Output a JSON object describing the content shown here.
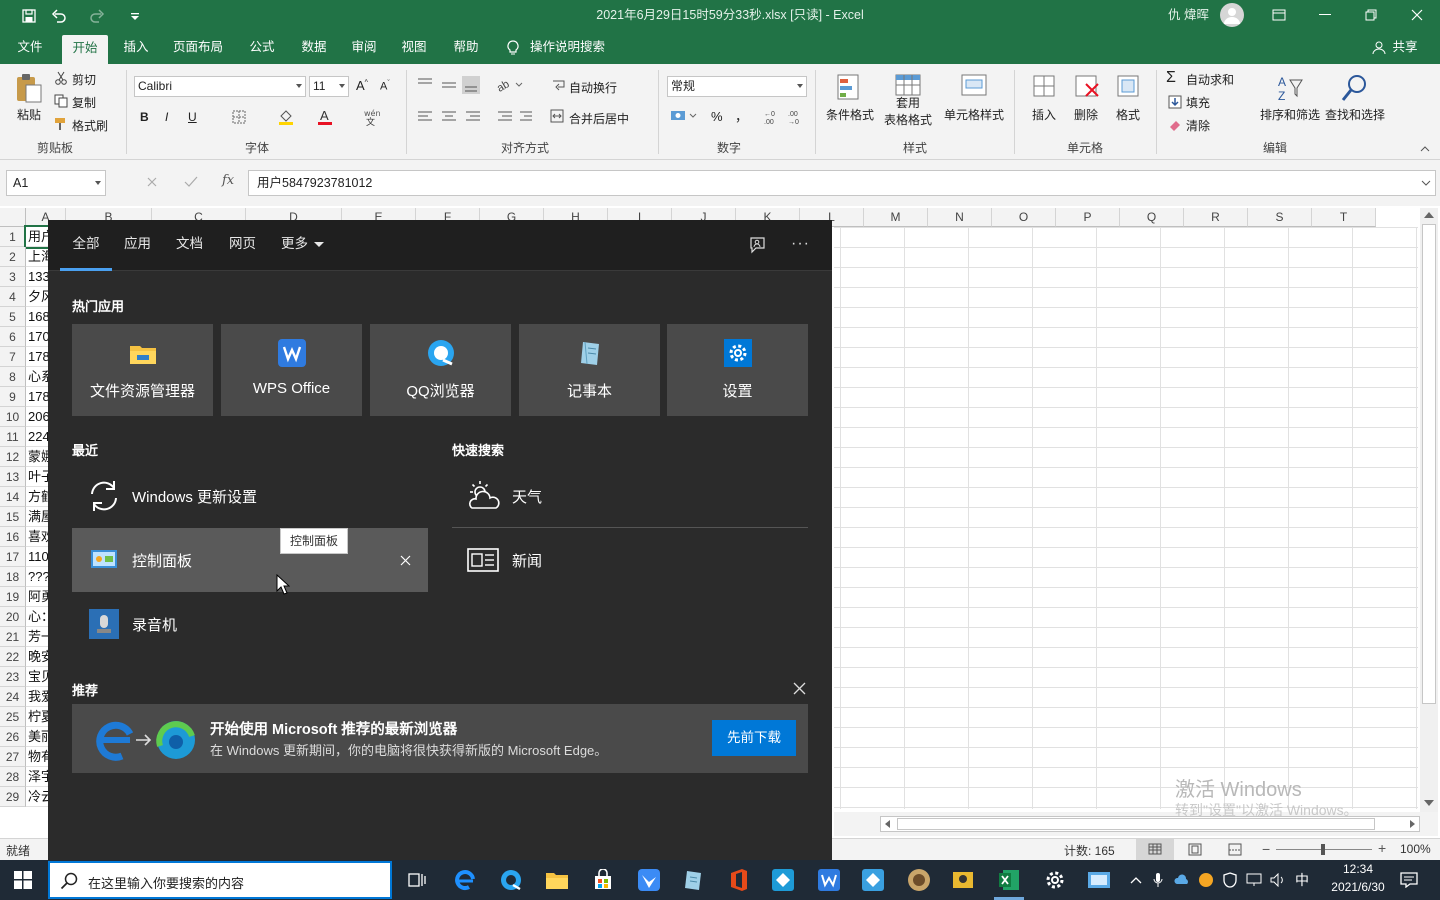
{
  "title_bar": {
    "document_title": "2021年6月29日15时59分33秒.xlsx [只读] - Excel",
    "user": "仇 煒晖",
    "brand_color": "#217346"
  },
  "ribbon_tabs": [
    "文件",
    "开始",
    "插入",
    "页面布局",
    "公式",
    "数据",
    "审阅",
    "视图",
    "帮助"
  ],
  "tell_me": "操作说明搜索",
  "share": "共享",
  "clipboard": {
    "paste": "粘贴",
    "cut": "剪切",
    "copy": "复制",
    "format_painter": "格式刷",
    "group": "剪贴板"
  },
  "font": {
    "name": "Calibri",
    "size": "11",
    "bold": "B",
    "italic": "I",
    "underline": "U",
    "group": "字体"
  },
  "alignment": {
    "wrap": "自动换行",
    "merge": "合并后居中",
    "group": "对齐方式"
  },
  "number": {
    "format": "常规",
    "percent": "%",
    "comma": "，",
    "group": "数字"
  },
  "styles": {
    "conditional": "条件格式",
    "table_1": "套用",
    "table_2": "表格格式",
    "cell_styles": "单元格样式",
    "group": "样式"
  },
  "cells": {
    "insert": "插入",
    "delete": "删除",
    "format": "格式",
    "group": "单元格"
  },
  "editing": {
    "autosum": "自动求和",
    "fill": "填充",
    "clear": "清除",
    "sort": "排序和筛选",
    "find": "查找和选择",
    "group": "编辑"
  },
  "formula_bar": {
    "name_box": "A1",
    "fx": "fx",
    "content": "用户5847923781012"
  },
  "columns": [
    "A",
    "B",
    "C",
    "D",
    "E",
    "F",
    "G",
    "H",
    "I",
    "J",
    "K",
    "L",
    "M",
    "N",
    "O",
    "P",
    "Q",
    "R",
    "S",
    "T"
  ],
  "rows": [
    {
      "n": "1",
      "a": "用户"
    },
    {
      "n": "2",
      "a": "上海"
    },
    {
      "n": "3",
      "a": "133"
    },
    {
      "n": "4",
      "a": "夕风"
    },
    {
      "n": "5",
      "a": "168"
    },
    {
      "n": "6",
      "a": "170"
    },
    {
      "n": "7",
      "a": "178"
    },
    {
      "n": "8",
      "a": "心系"
    },
    {
      "n": "9",
      "a": "178"
    },
    {
      "n": "10",
      "a": "206"
    },
    {
      "n": "11",
      "a": "224"
    },
    {
      "n": "12",
      "a": "蒙娜"
    },
    {
      "n": "13",
      "a": "叶子"
    },
    {
      "n": "14",
      "a": "方鹤"
    },
    {
      "n": "15",
      "a": "满屋"
    },
    {
      "n": "16",
      "a": "喜欢"
    },
    {
      "n": "17",
      "a": "110"
    },
    {
      "n": "18",
      "a": "???"
    },
    {
      "n": "19",
      "a": "阿勇"
    },
    {
      "n": "20",
      "a": "心："
    },
    {
      "n": "21",
      "a": "芳一"
    },
    {
      "n": "22",
      "a": "晚安"
    },
    {
      "n": "23",
      "a": "宝贝"
    },
    {
      "n": "24",
      "a": "我爱"
    },
    {
      "n": "25",
      "a": "柠夏"
    },
    {
      "n": "26",
      "a": "美丽"
    },
    {
      "n": "27",
      "a": "物有"
    },
    {
      "n": "28",
      "a": "泽宇"
    },
    {
      "n": "29",
      "a": "冷云"
    }
  ],
  "status_bar": {
    "ready": "就绪",
    "count": "计数: 165",
    "zoom": "100%"
  },
  "watermark": {
    "line1": "激活 Windows",
    "line2": "转到\"设置\"以激活 Windows。"
  },
  "search_panel": {
    "tabs": [
      "全部",
      "应用",
      "文档",
      "网页",
      "更多"
    ],
    "top_apps_title": "热门应用",
    "top_apps": [
      {
        "name": "文件资源管理器",
        "icon": "folder-icon"
      },
      {
        "name": "WPS Office",
        "icon": "wps-icon"
      },
      {
        "name": "QQ浏览器",
        "icon": "qq-browser-icon"
      },
      {
        "name": "记事本",
        "icon": "notepad-icon"
      },
      {
        "name": "设置",
        "icon": "settings-icon"
      }
    ],
    "recent_title": "最近",
    "recent": [
      "Windows 更新设置",
      "控制面板",
      "录音机"
    ],
    "quick_title": "快速搜索",
    "quick": [
      "天气",
      "新闻"
    ],
    "tooltip": "控制面板",
    "recommend_title": "推荐",
    "promo": {
      "title": "开始使用 Microsoft 推荐的最新浏览器",
      "subtitle": "在 Windows 更新期间，你的电脑将很快获得新版的 Microsoft Edge。",
      "button": "先前下载"
    }
  },
  "taskbar": {
    "search_placeholder": "在这里输入你要搜索的内容",
    "time": "12:34",
    "date": "2021/6/30",
    "ime": "中"
  }
}
